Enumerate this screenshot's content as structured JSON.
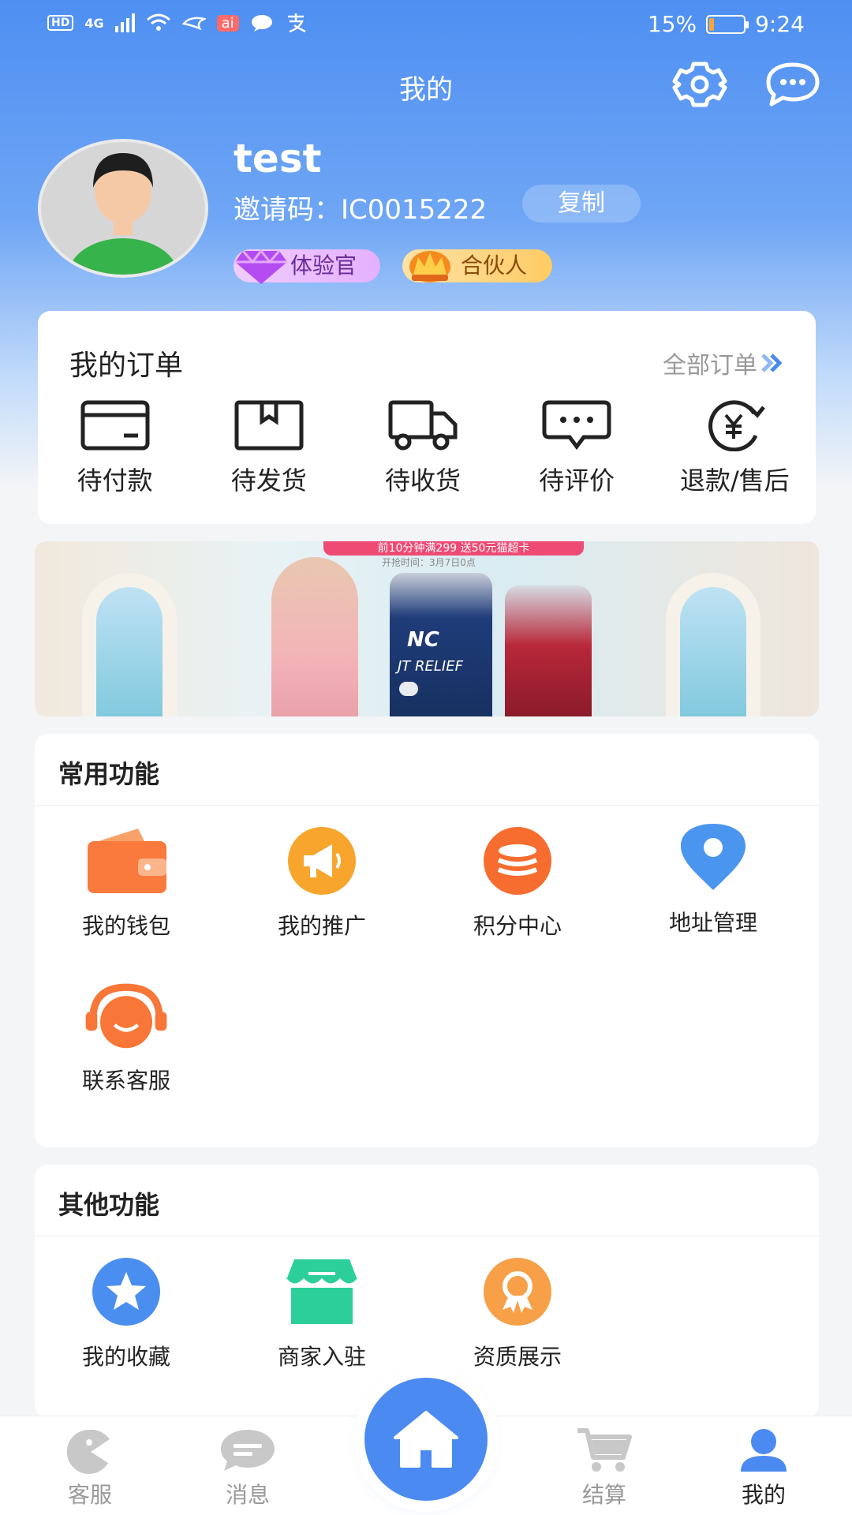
{
  "status_bar": {
    "network": "4G",
    "ai_badge": "ai",
    "battery_text": "15%",
    "battery_level": 0.15,
    "time": "9:24"
  },
  "header": {
    "title": "我的",
    "settings_icon": "gear-icon",
    "message_icon": "chat-bubble-icon"
  },
  "profile": {
    "username": "test",
    "invite_label": "邀请码：IC0015222",
    "copy_label": "复制",
    "badges": [
      {
        "label": "体验官",
        "icon": "diamond-icon"
      },
      {
        "label": "合伙人",
        "icon": "crown-icon"
      }
    ]
  },
  "orders": {
    "title": "我的订单",
    "all_label": "全部订单",
    "items": [
      {
        "label": "待付款",
        "icon": "card-icon"
      },
      {
        "label": "待发货",
        "icon": "box-icon"
      },
      {
        "label": "待收货",
        "icon": "truck-icon"
      },
      {
        "label": "待评价",
        "icon": "comment-icon"
      },
      {
        "label": "退款/售后",
        "icon": "refund-icon"
      }
    ]
  },
  "banner": {
    "headline": "前10分钟满299 送50元猫超卡",
    "subline": "开抢时间：3月7日0点",
    "brand": "NC",
    "product_text": "JT RELIEF"
  },
  "common_functions": {
    "title": "常用功能",
    "items": [
      {
        "label": "我的钱包",
        "icon": "wallet-icon",
        "color": "#f97a3c"
      },
      {
        "label": "我的推广",
        "icon": "megaphone-icon",
        "color": "#f7a52d"
      },
      {
        "label": "积分中心",
        "icon": "coins-icon",
        "color": "#f76c2f"
      },
      {
        "label": "地址管理",
        "icon": "location-pin-icon",
        "color": "#4a95ee"
      },
      {
        "label": "联系客服",
        "icon": "headset-icon",
        "color": "#f87637"
      }
    ]
  },
  "other_functions": {
    "title": "其他功能",
    "items": [
      {
        "label": "我的收藏",
        "icon": "star-icon",
        "color": "#4a8ef0"
      },
      {
        "label": "商家入驻",
        "icon": "store-icon",
        "color": "#2ccf9a"
      },
      {
        "label": "资质展示",
        "icon": "award-icon",
        "color": "#f7a048"
      }
    ]
  },
  "tabbar": {
    "items": [
      {
        "label": "客服",
        "icon": "service-icon"
      },
      {
        "label": "消息",
        "icon": "message-icon"
      },
      {
        "label": "",
        "icon": "home-icon"
      },
      {
        "label": "结算",
        "icon": "cart-icon"
      },
      {
        "label": "我的",
        "icon": "user-icon"
      }
    ],
    "active_index": 4,
    "accent": "#4b8af0"
  }
}
